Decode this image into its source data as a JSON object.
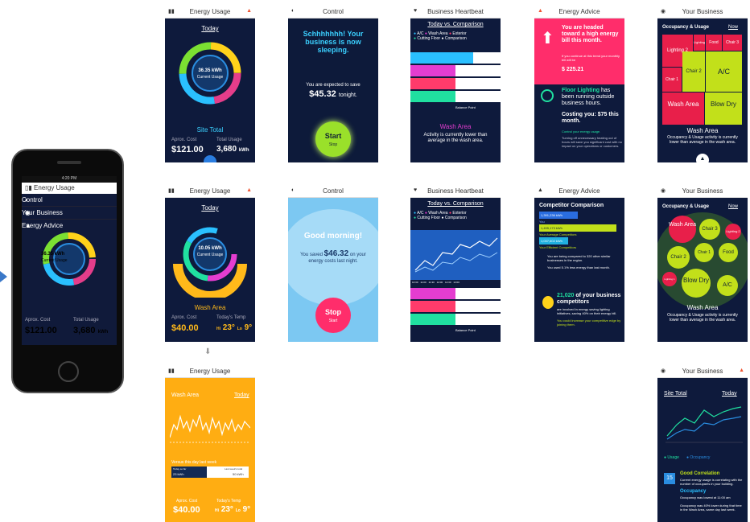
{
  "phone": {
    "time": "4:20 PM",
    "energy_usage": "Energy Usage",
    "menu": [
      "Control",
      "Your Business",
      "Energy Advice"
    ],
    "kwh": "36.35 kWh",
    "current_usage": "Current Usage",
    "aprox_cost": "Aprox. Cost",
    "total_usage": "Total Usage",
    "cost": "$121.00",
    "usage": "3,680",
    "kwh_unit": "kWh"
  },
  "s1": {
    "title": "Energy Usage",
    "today": "Today",
    "kwh": "36.35 kWh",
    "current": "Current Usage",
    "site_total": "Site Total",
    "aprox_cost": "Aprox. Cost",
    "total_usage": "Total Usage",
    "cost": "$121.00",
    "usage": "3,680",
    "unit": "kWh"
  },
  "s2": {
    "title": "Control",
    "sleep": "Schhhhhhh! Your business is now sleeping.",
    "expected": "You are expected to save",
    "save": "$45.32",
    "tonight": "tonight.",
    "start": "Start",
    "stop": "Stop"
  },
  "s3": {
    "title": "Business Heartbeat",
    "compare": "Today vs. Comparison",
    "legend": [
      "A/C",
      "Wash Area",
      "Exterior",
      "Cutting Floor",
      "Comparison"
    ],
    "balance": "Balance Point",
    "area": "Wash Area",
    "note": "Activity is currently lower than average in the wash area."
  },
  "s4": {
    "title": "Energy Advice",
    "headed": "You are headed toward a high energy bill this month.",
    "small": "If you continue at this trend your monthly bill will be",
    "bill": "$ 225.21",
    "floor": "Floor Lighting",
    "floor_rest": "has been running outside business hours.",
    "costing": "Costing you: $75 this month.",
    "control": "Control your energy usage.",
    "turn": "Turning off unnecessary heating out of hours will save you significant cost with no impact on your operations or customers."
  },
  "s5": {
    "title": "Your Business",
    "occ": "Occupancy & Usage",
    "now": "Now",
    "cells": [
      "Lighting 2",
      "Lighting 1",
      "Food",
      "Chair 3",
      "Chair 1",
      "Chair 2",
      "A/C",
      "Wash Area",
      "Blow Dry"
    ],
    "area": "Wash Area",
    "note": "Occupancy & Usage activity is currently lower than average in the wash area."
  },
  "s6": {
    "title": "Energy Usage",
    "today": "Today",
    "kwh": "10.05 kWh",
    "current": "Current Usage",
    "area": "Wash Area",
    "aprox_cost": "Aprox. Cost",
    "temp_label": "Today's Temp",
    "cost": "$40.00",
    "hi": "Hi",
    "hi_val": "23°",
    "lo": "Lo",
    "lo_val": "9°"
  },
  "s7": {
    "title": "Control",
    "morning": "Good morning!",
    "saved": "You saved",
    "amount": "$46.32",
    "rest": "on your energy costs last night.",
    "stop": "Stop",
    "start": "Start"
  },
  "s8": {
    "title": "Business Heartbeat",
    "compare": "Today vs. Comparison",
    "legend": [
      "A/C",
      "Wash Area",
      "Exterior",
      "Cutting Floor",
      "Comparison"
    ],
    "balance": "Balance Point",
    "times": [
      "10:30",
      "10:45",
      "11:00",
      "11:15",
      "11:30",
      "11:45",
      "12:00",
      "12:15",
      "12:30",
      "12:45",
      "13:00"
    ]
  },
  "s9": {
    "title": "Energy Advice",
    "comp": "Competitor Comparison",
    "v1": "1,391,236 kWh",
    "you": "You",
    "v2": "1,495,173 kWh",
    "avg": "Your Average Competitors",
    "v3": "1,037,602 kWh",
    "eff": "Your Efficient Competitors",
    "n1": "You are being compared to 320 other similar businesses in the region.",
    "n2": "You used 5.1% less energy than last month.",
    "big": "21,020",
    "big_rest": "of your business competitors",
    "small": "are involved in energy saving lighting initiatives, saving 40% on their energy bill.",
    "link": "You could increase your competitive edge by joining them."
  },
  "s10": {
    "title": "Your Business",
    "occ": "Occupancy & Usage",
    "now": "Now",
    "circles": [
      "Wash Area",
      "Chair 3",
      "Lighting 2",
      "Chair 1",
      "Food",
      "Chair 2",
      "Lighting 1",
      "Blow Dry",
      "A/C"
    ],
    "area": "Wash Area",
    "note": "Occupancy & Usage activity is currently lower than average in the wash area."
  },
  "s11": {
    "title": "Energy Usage",
    "area": "Wash Area",
    "today": "Today",
    "versus": "Versus this day last week",
    "today_so_far": "Today so far",
    "last_week": "Last week's total",
    "v1": "23 kWh",
    "v2": "50 kWh",
    "aprox_cost": "Aprox. Cost",
    "temp_label": "Today's Temp",
    "cost": "$40.00",
    "hi": "Hi",
    "hi_val": "23°",
    "lo": "Lo",
    "lo_val": "9°"
  },
  "s12": {
    "title": "Your Business",
    "site_total": "Site Total",
    "today": "Today",
    "usage": "Usage",
    "occupancy": "Occupancy",
    "num": "15",
    "good": "Good Correlation",
    "good_text": "Current energy usage is correlating with the number of occupants in your building.",
    "occ_title": "Occupancy",
    "occ_text": "Occupancy was lowest at 11:00 am",
    "occ_text2": "Occupancy was 40% lower during that time in the Wash Area, same day last week."
  }
}
